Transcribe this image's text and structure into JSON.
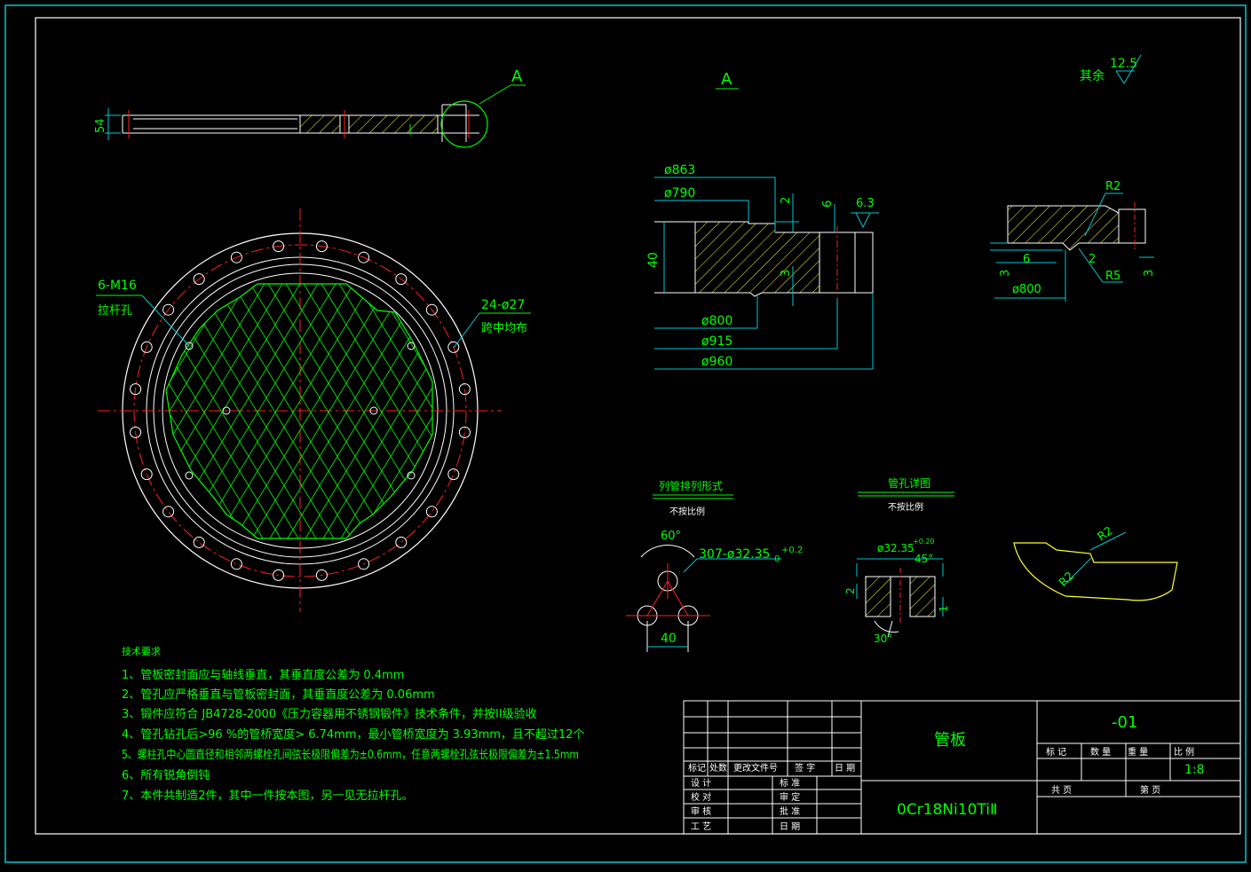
{
  "colors": {
    "frame": "#ffffff",
    "outer": "#00c8d0",
    "green": "#00ff00",
    "cyan": "#00c8d0",
    "red": "#ff2020",
    "yellow": "#ffff30",
    "white": "#ffffff"
  },
  "top_view": {
    "label": "A",
    "dim_thickness": "54"
  },
  "main_view": {
    "tie_rod_label": "6-M16",
    "tie_rod_name": "拉杆孔",
    "bolt_holes_label": "24-ø27",
    "bolt_holes_note": "跨中均布"
  },
  "detail_a": {
    "title": "A",
    "dims": [
      "ø863",
      "ø790",
      "ø800",
      "ø915",
      "ø960",
      "40",
      "2",
      "6",
      "3"
    ],
    "roughness": "6.3"
  },
  "detail_b": {
    "dims": [
      "R2",
      "R5",
      "6",
      "2",
      "3",
      "3",
      "ø800"
    ]
  },
  "roughness_rest": {
    "label": "其余",
    "value": "12.5"
  },
  "tube_pattern": {
    "title": "列管排列形式",
    "scale": "不按比例",
    "angle": "60°",
    "holes": "307-ø32.35",
    "tol_upper": "+0.2",
    "tol_lower": "0",
    "pitch": "40"
  },
  "tube_hole": {
    "title": "管孔详图",
    "scale": "不按比例",
    "dia": "ø32.35",
    "tol": "+0.20",
    "angle1": "45°",
    "angle2": "30°",
    "dim_left": "2",
    "dim_right": "1"
  },
  "edge_detail": {
    "r1": "R2",
    "r2": "R2"
  },
  "requirements": {
    "heading": "技术要求",
    "items": [
      "1、管板密封面应与轴线垂直，其垂直度公差为    0.4mm",
      "2、管孔应严格垂直与管板密封面，其垂直度公差为    0.06mm",
      "3、锻件应符合 JB4728-2000《压力容器用不锈钢锻件》技术条件，并按II级验收",
      "4、管孔钻孔后>96 %的管桥宽度> 6.74mm，最小管桥宽度为 3.93mm，且不超过12个",
      "5、螺柱孔中心圆直径和相邻两螺栓孔间弦长极限偏差为±0.6mm，任意两螺栓孔弦长极限偏差为±1.5mm",
      "6、所有锐角倒钝",
      "7、本件共制造2件，其中一件按本图，另一见无拉杆孔。"
    ]
  },
  "title_block": {
    "name": "管板",
    "material": "0Cr18Ni10TiⅡ",
    "drawing_no": "-01",
    "scale": "1:8",
    "rev_headers": [
      "标记",
      "处数",
      "更改文件号",
      "签 字",
      "日 期"
    ],
    "sign_rows": [
      [
        "设 计",
        "标 准"
      ],
      [
        "校 对",
        "审 定"
      ],
      [
        "审 核",
        "批 准"
      ],
      [
        "工 艺",
        "日 期"
      ]
    ],
    "right_headers": [
      "标 记",
      "数 量",
      "重 量",
      "比 例"
    ],
    "page_labels": [
      "共  页",
      "第  页"
    ]
  }
}
